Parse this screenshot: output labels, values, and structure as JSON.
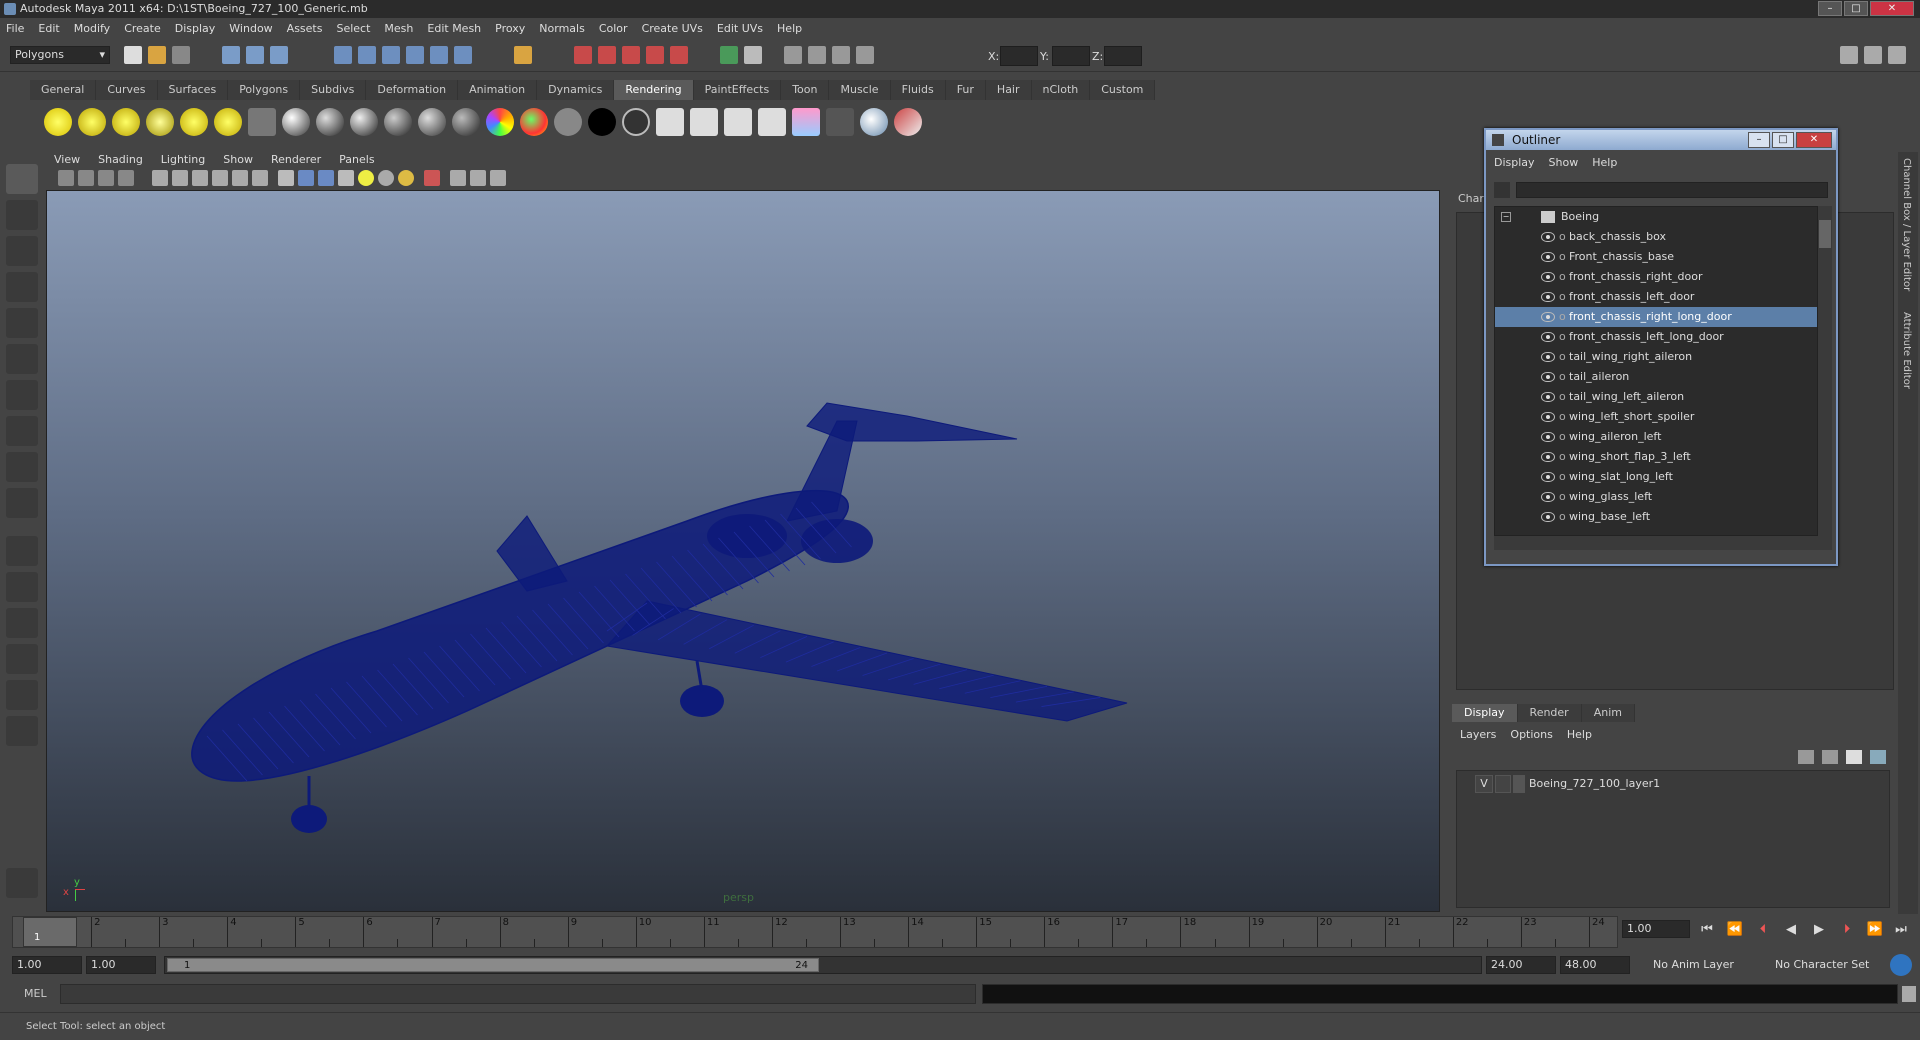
{
  "window": {
    "title": "Autodesk Maya 2011 x64: D:\\1ST\\Boeing_727_100_Generic.mb",
    "minimize": "–",
    "maximize": "□",
    "close": "✕"
  },
  "menu": [
    "File",
    "Edit",
    "Modify",
    "Create",
    "Display",
    "Window",
    "Assets",
    "Select",
    "Mesh",
    "Edit Mesh",
    "Proxy",
    "Normals",
    "Color",
    "Create UVs",
    "Edit UVs",
    "Help"
  ],
  "status": {
    "mode": "Polygons",
    "x_label": "X:",
    "y_label": "Y:",
    "z_label": "Z:"
  },
  "shelf": {
    "tabs": [
      "General",
      "Curves",
      "Surfaces",
      "Polygons",
      "Subdivs",
      "Deformation",
      "Animation",
      "Dynamics",
      "Rendering",
      "PaintEffects",
      "Toon",
      "Muscle",
      "Fluids",
      "Fur",
      "Hair",
      "nCloth",
      "Custom"
    ],
    "active_tab": "Rendering"
  },
  "viewport": {
    "menu": [
      "View",
      "Shading",
      "Lighting",
      "Show",
      "Renderer",
      "Panels"
    ],
    "camera_label": "persp",
    "axis_x": "x",
    "axis_y": "y",
    "wire_color": "#0d1a7a"
  },
  "channel_box": {
    "label": "Char"
  },
  "side_tabs": [
    "Channel Box / Layer Editor",
    "Attribute Editor"
  ],
  "outliner": {
    "title": "Outliner",
    "menu": [
      "Display",
      "Show",
      "Help"
    ],
    "root": "Boeing",
    "items": [
      {
        "label": "back_chassis_box",
        "selected": false
      },
      {
        "label": "Front_chassis_base",
        "selected": false
      },
      {
        "label": "front_chassis_right_door",
        "selected": false
      },
      {
        "label": "front_chassis_left_door",
        "selected": false
      },
      {
        "label": "front_chassis_right_long_door",
        "selected": true
      },
      {
        "label": "front_chassis_left_long_door",
        "selected": false
      },
      {
        "label": "tail_wing_right_aileron",
        "selected": false
      },
      {
        "label": "tail_aileron",
        "selected": false
      },
      {
        "label": "tail_wing_left_aileron",
        "selected": false
      },
      {
        "label": "wing_left_short_spoiler",
        "selected": false
      },
      {
        "label": "wing_aileron_left",
        "selected": false
      },
      {
        "label": "wing_short_flap_3_left",
        "selected": false
      },
      {
        "label": "wing_slat_long_left",
        "selected": false
      },
      {
        "label": "wing_glass_left",
        "selected": false
      },
      {
        "label": "wing_base_left",
        "selected": false
      }
    ]
  },
  "layer_editor": {
    "tabs": [
      "Display",
      "Render",
      "Anim"
    ],
    "active_tab": "Display",
    "menu": [
      "Layers",
      "Options",
      "Help"
    ],
    "layer": {
      "visible": "V",
      "name": "Boeing_727_100_layer1"
    }
  },
  "timeline": {
    "ticks": [
      "1",
      "2",
      "3",
      "4",
      "5",
      "6",
      "7",
      "8",
      "9",
      "10",
      "11",
      "12",
      "13",
      "14",
      "15",
      "16",
      "17",
      "18",
      "19",
      "20",
      "21",
      "22",
      "23",
      "24"
    ],
    "current_frame": "1.00",
    "current_marker": "1"
  },
  "range": {
    "start_time": "1.00",
    "start_playback": "1.00",
    "range_start": "1",
    "range_end": "24",
    "end_playback": "24.00",
    "end_time": "48.00",
    "anim_layer": "No Anim Layer",
    "character_set": "No Character Set"
  },
  "command": {
    "label": "MEL"
  },
  "help_line": "Select Tool: select an object"
}
